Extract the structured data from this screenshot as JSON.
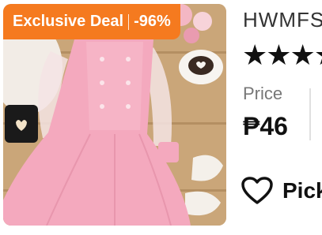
{
  "product": {
    "image_alt_subject": "pink dress",
    "badge": {
      "label": "Exclusive Deal",
      "discount": "-96%",
      "color": "#F57A1F"
    },
    "brand_name": "HWMFS",
    "rating_stars": "★★★★",
    "price_label": "Price",
    "price_value": "₱46",
    "pick_label": "Pick"
  },
  "icons": {
    "wishlist": "heart-outline-icon",
    "rating": "star-icon"
  },
  "colors": {
    "badge_orange": "#F57A1F",
    "dress_pink": "#F4A9BE",
    "background_wood": "#C9A77A"
  }
}
